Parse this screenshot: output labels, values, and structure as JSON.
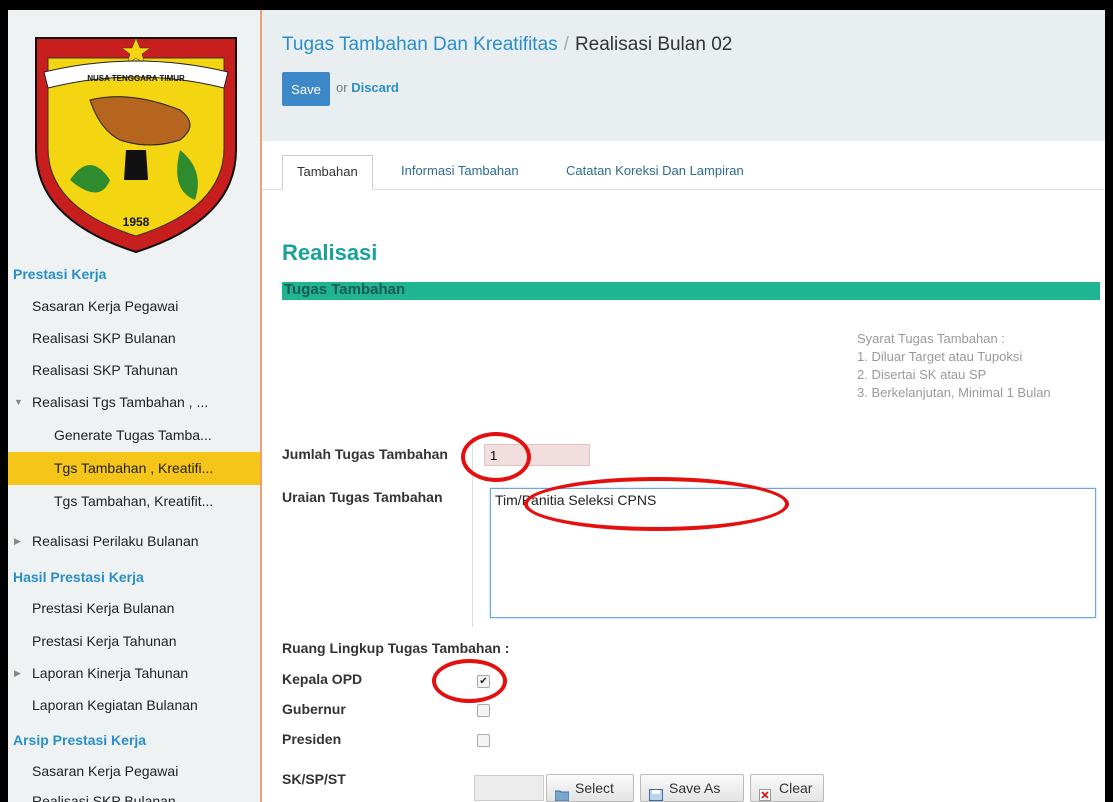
{
  "logo": {
    "banner_text": "NUSA TENGGARA TIMUR",
    "year": "1958"
  },
  "sidebar": {
    "sections": [
      {
        "title": "Prestasi Kerja"
      },
      {
        "title": "Hasil Prestasi Kerja"
      },
      {
        "title": "Arsip Prestasi Kerja"
      }
    ],
    "items": [
      {
        "label": "Sasaran Kerja Pegawai"
      },
      {
        "label": "Realisasi SKP Bulanan"
      },
      {
        "label": "Realisasi SKP Tahunan"
      },
      {
        "label": "Realisasi Tgs Tambahan , ..."
      },
      {
        "label": "Generate Tugas Tamba..."
      },
      {
        "label": "Tgs Tambahan , Kreatifi..."
      },
      {
        "label": "Tgs Tambahan, Kreatifit..."
      },
      {
        "label": "Realisasi Perilaku Bulanan"
      },
      {
        "label": "Prestasi Kerja Bulanan"
      },
      {
        "label": "Prestasi Kerja Tahunan"
      },
      {
        "label": "Laporan Kinerja Tahunan"
      },
      {
        "label": "Laporan Kegiatan Bulanan"
      },
      {
        "label": "Sasaran Kerja Pegawai"
      },
      {
        "label": "Realisasi SKP Bulanan"
      }
    ]
  },
  "breadcrumb": {
    "parent": "Tugas Tambahan Dan Kreatifitas",
    "separator": "/",
    "current": "Realisasi Bulan 02"
  },
  "actions": {
    "save": "Save",
    "or": "or",
    "discard": "Discard"
  },
  "tabs": [
    {
      "label": "Tambahan"
    },
    {
      "label": "Informasi Tambahan"
    },
    {
      "label": "Catatan Koreksi Dan Lampiran"
    }
  ],
  "form": {
    "heading": "Realisasi",
    "section": "Tugas Tambahan",
    "syarat": {
      "title": "Syarat Tugas Tambahan :",
      "lines": [
        "1. Diluar Target atau Tupoksi",
        "2. Disertai SK atau SP",
        "3. Berkelanjutan, Minimal 1 Bulan"
      ]
    },
    "jumlah_label": "Jumlah Tugas Tambahan",
    "jumlah_value": "1",
    "uraian_label": "Uraian Tugas Tambahan",
    "uraian_value": "Tim/Panitia Seleksi CPNS",
    "ruang_label": "Ruang Lingkup Tugas Tambahan :",
    "scopes": [
      {
        "label": "Kepala OPD",
        "checked": true
      },
      {
        "label": "Gubernur",
        "checked": false
      },
      {
        "label": "Presiden",
        "checked": false
      }
    ],
    "file_label": "SK/SP/ST",
    "file_buttons": {
      "select": "Select",
      "save_as": "Save As",
      "clear": "Clear"
    }
  },
  "colors": {
    "accent": "#2a8fc8",
    "save_button": "#3c88c9",
    "active_menu": "#f5c51a",
    "section_band": "#1fb592",
    "annotation_ring": "#e3100f"
  }
}
